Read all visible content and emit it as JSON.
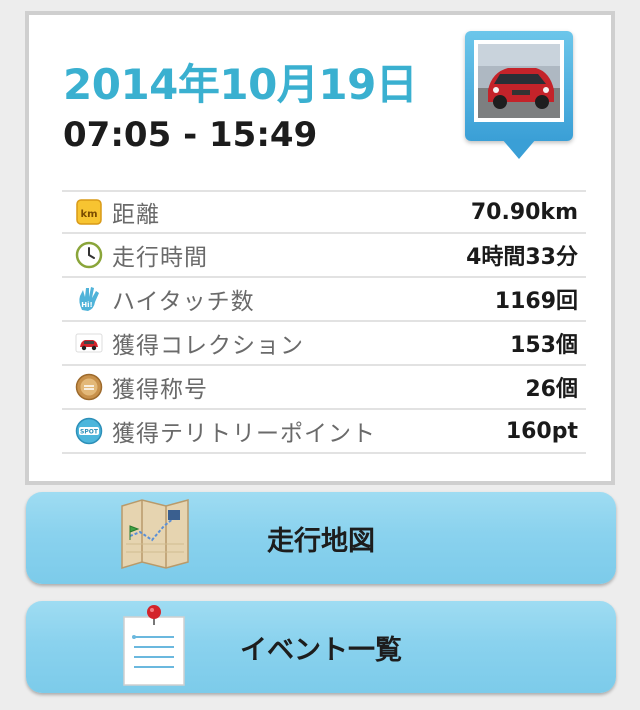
{
  "drive": {
    "date": "2014年10月19日",
    "time_range": "07:05 - 15:49"
  },
  "stats": [
    {
      "icon": "km-icon",
      "label": "距離",
      "value": "70.90km"
    },
    {
      "icon": "clock-icon",
      "label": "走行時間",
      "value": "4時間33分"
    },
    {
      "icon": "hi-five-hand-icon",
      "label": "ハイタッチ数",
      "value": "1169回"
    },
    {
      "icon": "red-car-icon",
      "label": "獲得コレクション",
      "value": "153個"
    },
    {
      "icon": "title-medal-icon",
      "label": "獲得称号",
      "value": "26個"
    },
    {
      "icon": "spot-badge-icon",
      "label": "獲得テリトリーポイント",
      "value": "160pt"
    }
  ],
  "buttons": {
    "map_label": "走行地図",
    "events_label": "イベント一覧"
  },
  "colors": {
    "date_text": "#3ab0d0",
    "button_blue": "#8ad2ee",
    "pin_blue": "#3a9fd6"
  }
}
